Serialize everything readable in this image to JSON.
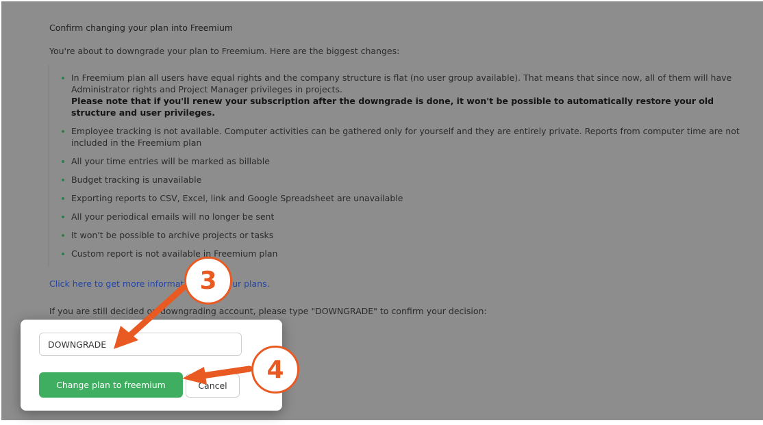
{
  "page": {
    "title": "Confirm changing your plan into Freemium",
    "intro": "You're about to downgrade your plan to Freemium. Here are the biggest changes:",
    "changes": [
      {
        "text": "In Freemium plan all users have equal rights and the company structure is flat (no user group available). That means that since now, all of them will have Administrator rights and Project Manager privileges in projects.",
        "bold": "Please note that if you'll renew your subscription after the downgrade is done, it won't be possible to automatically restore your old structure and user privileges."
      },
      {
        "text": "Employee tracking is not available. Computer activities can be gathered only for yourself and they are entirely private. Reports from computer time are not included in the Freemium plan"
      },
      {
        "text": "All your time entries will be marked as billable"
      },
      {
        "text": "Budget tracking is unavailable"
      },
      {
        "text": "Exporting reports to CSV, Excel, link and Google Spreadsheet are unavailable"
      },
      {
        "text": "All your periodical emails will no longer be sent"
      },
      {
        "text": "It won't be possible to archive projects or tasks"
      },
      {
        "text": "Custom report is not available in Freemium plan"
      }
    ],
    "more_info_link": "Click here to get more information about our plans.",
    "confirm_prompt": "If you are still decided on downgrading account, please type \"DOWNGRADE\" to confirm your decision:"
  },
  "dialog": {
    "input_value": "DOWNGRADE",
    "confirm_button": "Change plan to freemium",
    "cancel_button": "Cancel"
  },
  "annotations": {
    "step_3": "3",
    "step_4": "4",
    "color": "#e85a22"
  }
}
